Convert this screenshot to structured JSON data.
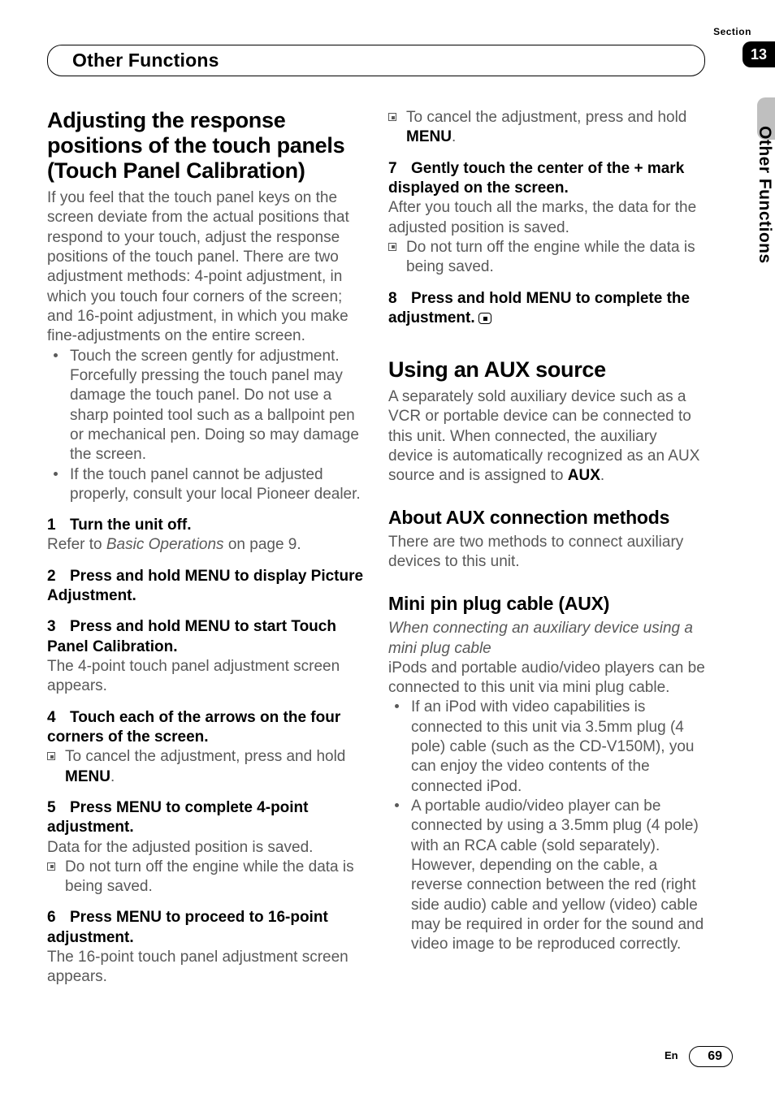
{
  "header": {
    "section_label": "Section",
    "section_number": "13",
    "chapter_title": "Other Functions",
    "side_tab": "Other Functions"
  },
  "left": {
    "h1": "Adjusting the response positions of the touch panels (Touch Panel Calibration)",
    "intro": "If you feel that the touch panel keys on the screen deviate from the actual positions that respond to your touch, adjust the response positions of the touch panel. There are two adjustment methods: 4-point adjustment, in which you touch four corners of the screen; and 16-point adjustment, in which you make fine-adjustments on the entire screen.",
    "bullets": [
      "Touch the screen gently for adjustment. Forcefully pressing the touch panel may damage the touch panel. Do not use a sharp pointed tool such as a ballpoint pen or mechanical pen. Doing so may damage the screen.",
      "If the touch panel cannot be adjusted properly, consult your local Pioneer dealer."
    ],
    "step1_num": "1",
    "step1_title": "Turn the unit off.",
    "step1_body_a": "Refer to ",
    "step1_body_b": "Basic Operations",
    "step1_body_c": " on page 9.",
    "step2_num": "2",
    "step2_title": "Press and hold MENU to display Picture Adjustment.",
    "step3_num": "3",
    "step3_title": "Press and hold MENU to start Touch Panel Calibration.",
    "step3_body": "The 4-point touch panel adjustment screen appears.",
    "step4_num": "4",
    "step4_title": "Touch each of the arrows on the four corners of the screen.",
    "step4_note_a": "To cancel the adjustment, press and hold ",
    "step4_note_b": "MENU",
    "step4_note_c": ".",
    "step5_num": "5",
    "step5_title": "Press MENU to complete 4-point adjustment.",
    "step5_body": "Data for the adjusted position is saved.",
    "step5_note": "Do not turn off the engine while the data is being saved.",
    "step6_num": "6",
    "step6_title": "Press MENU to proceed to 16-point adjustment.",
    "step6_body": "The 16-point touch panel adjustment screen appears."
  },
  "right": {
    "cont_note_a": "To cancel the adjustment, press and hold ",
    "cont_note_b": "MENU",
    "cont_note_c": ".",
    "step7_num": "7",
    "step7_title": "Gently touch the center of the + mark displayed on the screen.",
    "step7_body": "After you touch all the marks, the data for the adjusted position is saved.",
    "step7_note": "Do not turn off the engine while the data is being saved.",
    "step8_num": "8",
    "step8_title": "Press and hold MENU to complete the adjustment.",
    "aux_h1": "Using an AUX source",
    "aux_intro_a": "A separately sold auxiliary device such as a VCR or portable device can be connected to this unit. When connected, the auxiliary device is automatically recognized as an AUX source and is assigned to ",
    "aux_intro_b": "AUX",
    "aux_intro_c": ".",
    "about_h2": "About AUX connection methods",
    "about_body": "There are two methods to connect auxiliary devices to this unit.",
    "mini_h2": "Mini pin plug cable (AUX)",
    "mini_sub": "When connecting an auxiliary device using a mini plug cable",
    "mini_body": "iPods and portable audio/video players can be connected to this unit via mini plug cable.",
    "mini_bullets": [
      "If an iPod with video capabilities is connected to this unit via 3.5mm plug (4 pole) cable (such as the CD-V150M), you can enjoy the video contents of the connected iPod.",
      "A portable audio/video player can be connected by using a 3.5mm plug (4 pole) with an RCA cable (sold separately). However, depending on the cable, a reverse connection between the red (right side audio) cable and yellow (video) cable may be required in order for the sound and video image to be reproduced correctly."
    ]
  },
  "footer": {
    "lang": "En",
    "page": "69"
  }
}
